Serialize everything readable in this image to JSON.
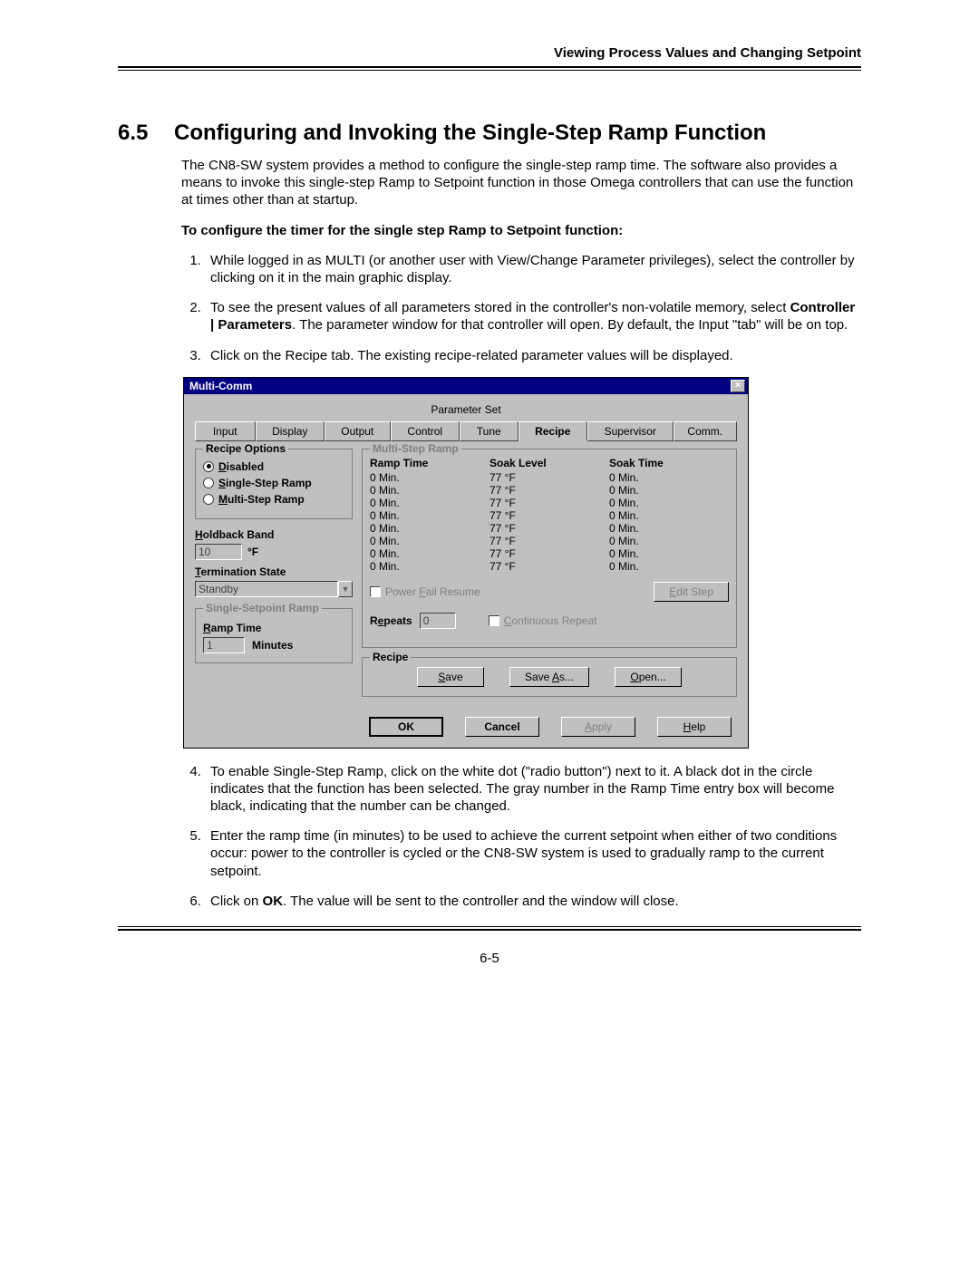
{
  "header": {
    "right": "Viewing Process Values and Changing Setpoint"
  },
  "section": {
    "number": "6.5",
    "title": "Configuring and Invoking the Single-Step Ramp Function"
  },
  "intro": "The CN8-SW system provides a method to configure the single-step ramp time.  The software also provides a means to invoke this single-step Ramp to Setpoint function in those Omega controllers that can use the function at times other than at startup.",
  "subhead": "To configure the timer for the single step Ramp to Setpoint function:",
  "step1": "While logged in as MULTI (or another user with View/Change Parameter privileges), select the controller by clicking on it in the main graphic display.",
  "step2a": "To see the present values of all parameters stored in the controller's non-volatile memory, select ",
  "step2b": "Controller | Parameters",
  "step2c": ".  The parameter window for that controller will open.  By default, the Input \"tab\" will be on top.",
  "step3": "Click on the Recipe tab.  The existing recipe-related parameter values will be displayed.",
  "step4": "To enable Single-Step Ramp, click on the white dot (\"radio button\") next to it.  A black dot in the circle indicates that the function has been selected.  The gray number in the Ramp Time entry box will become black, indicating that the number can be changed.",
  "step5": "Enter the ramp time (in minutes) to be used to achieve the current setpoint when either of two conditions occur:  power to the controller is cycled or the CN8-SW system is used to gradually ramp to the current setpoint.",
  "step6a": "Click on ",
  "step6b": "OK",
  "step6c": ".  The value will be sent to the controller and the window will close.",
  "dlg": {
    "title": "Multi-Comm",
    "ps": "Parameter Set",
    "tabs": [
      "Input",
      "Display",
      "Output",
      "Control",
      "Tune",
      "Recipe",
      "Supervisor",
      "Comm."
    ],
    "recipeOptions": {
      "legend": "Recipe Options",
      "r1": "Disabled",
      "r2": "Single-Step Ramp",
      "r3": "Multi-Step Ramp"
    },
    "holdback": {
      "label": "Holdback Band",
      "value": "10",
      "unit": "°F"
    },
    "term": {
      "label": "Termination State",
      "value": "Standby"
    },
    "sspr": {
      "legend": "Single-Setpoint Ramp",
      "rtlabel": "Ramp Time",
      "value": "1",
      "unit": "Minutes"
    },
    "msr": {
      "legend": "Multi-Step Ramp",
      "h1": "Ramp Time",
      "h2": "Soak Level",
      "h3": "Soak Time",
      "rows": [
        {
          "rt": "0 Min.",
          "sl": "77 °F",
          "st": "0 Min."
        },
        {
          "rt": "0 Min.",
          "sl": "77 °F",
          "st": "0 Min."
        },
        {
          "rt": "0 Min.",
          "sl": "77 °F",
          "st": "0 Min."
        },
        {
          "rt": "0 Min.",
          "sl": "77 °F",
          "st": "0 Min."
        },
        {
          "rt": "0 Min.",
          "sl": "77 °F",
          "st": "0 Min."
        },
        {
          "rt": "0 Min.",
          "sl": "77 °F",
          "st": "0 Min."
        },
        {
          "rt": "0 Min.",
          "sl": "77 °F",
          "st": "0 Min."
        },
        {
          "rt": "0 Min.",
          "sl": "77 °F",
          "st": "0 Min."
        }
      ],
      "pfr": "Power Fail Resume",
      "editStep": "Edit Step",
      "repeats": "Repeats",
      "repeatsVal": "0",
      "cr": "Continuous Repeat"
    },
    "recipeBox": {
      "legend": "Recipe",
      "save": "Save",
      "saveAs": "Save As...",
      "open": "Open..."
    },
    "ok": "OK",
    "cancel": "Cancel",
    "apply": "Apply",
    "help": "Help"
  },
  "footer": "6-5"
}
